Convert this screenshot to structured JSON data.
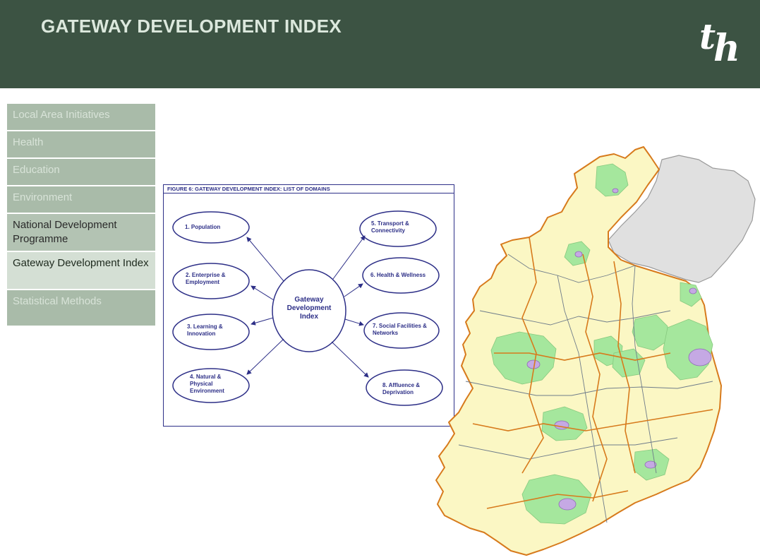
{
  "header": {
    "title": "GATEWAY DEVELOPMENT INDEX",
    "logo_text": "th",
    "background": "#3c5343"
  },
  "nav": {
    "items": [
      {
        "label": "Local Area Initiatives",
        "state": "muted"
      },
      {
        "label": "Health",
        "state": "muted"
      },
      {
        "label": "Education",
        "state": "muted"
      },
      {
        "label": "Environment",
        "state": "muted"
      },
      {
        "label": "National Development Programme",
        "state": "dark"
      },
      {
        "label": "Gateway Development Index",
        "state": "active"
      },
      {
        "label": "Statistical Methods",
        "state": "muted"
      }
    ]
  },
  "figure": {
    "caption": "FIGURE 6: GATEWAY DEVELOPMENT INDEX: LIST OF DOMAINS",
    "center": "Gateway Development Index",
    "domains": [
      "1. Population",
      "2. Enterprise & Employment",
      "3. Learning & Innovation",
      "4. Natural & Physical Environment",
      "5. Transport & Connectivity",
      "6. Health & Wellness",
      "7. Social Facilities & Networks",
      "8. Affluence & Deprivation"
    ],
    "line_color": "#2d2f87"
  },
  "map": {
    "colors": {
      "base": "#fbf7c4",
      "border": "#d77a1c",
      "inner_border": "#6f7c8a",
      "gateway": "#a5e79d",
      "urban": "#c5a9e4",
      "northern": "#e0e0e0"
    }
  }
}
